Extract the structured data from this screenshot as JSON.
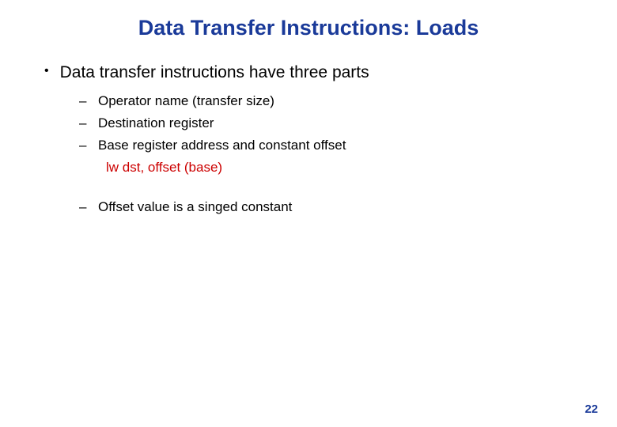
{
  "title": "Data Transfer Instructions: Loads",
  "bullet_main": "Data transfer instructions have three parts",
  "sub_items": {
    "item0": "Operator name (transfer size)",
    "item1": "Destination register",
    "item2": "Base register address and constant offset",
    "code": "lw dst, offset (base)",
    "item3": "Offset value is a singed constant"
  },
  "page_number": "22",
  "symbols": {
    "bullet": "•",
    "dash": "–"
  }
}
